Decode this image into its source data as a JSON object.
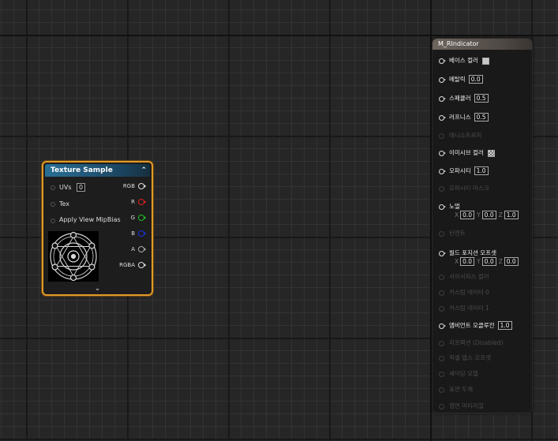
{
  "texture_node": {
    "title": "Texture Sample",
    "collapse_icon": "chevron-up",
    "expand_icon": "chevron-down",
    "inputs": [
      {
        "label": "UVs",
        "value": "0"
      },
      {
        "label": "Tex"
      },
      {
        "label": "Apply View MipBias"
      }
    ],
    "outputs": [
      {
        "label": "RGB",
        "color": "#dddddd"
      },
      {
        "label": "R",
        "color": "#e02020"
      },
      {
        "label": "G",
        "color": "#20c020"
      },
      {
        "label": "B",
        "color": "#2030e0"
      },
      {
        "label": "A",
        "color": "#aaaaaa"
      },
      {
        "label": "RGBA",
        "color": "#dddddd"
      }
    ],
    "thumbnail": "magic-circle-texture"
  },
  "material_node": {
    "title": "M_RIndicator",
    "rows": [
      {
        "label": "베이스 컬러",
        "enabled": true,
        "swatch": "#c8c8c8"
      },
      {
        "label": "메탈릭",
        "enabled": true,
        "value": "0.0"
      },
      {
        "label": "스페큘러",
        "enabled": true,
        "value": "0.5"
      },
      {
        "label": "러프니스",
        "enabled": true,
        "value": "0.5"
      },
      {
        "label": "애니소트로피",
        "enabled": false
      },
      {
        "label": "이미시브 컬러",
        "enabled": true,
        "swatch": "checker"
      },
      {
        "label": "오파시티",
        "enabled": true,
        "value": "1.0"
      },
      {
        "label": "오파시티 마스크",
        "enabled": false
      },
      {
        "label": "노멀",
        "enabled": true,
        "vector": [
          "0.0",
          "0.0",
          "1.0"
        ]
      },
      {
        "label": "탄젠트",
        "enabled": false
      },
      {
        "label": "월드 포지션 오프셋",
        "enabled": true,
        "vector": [
          "0.0",
          "0.0",
          "0.0"
        ]
      },
      {
        "label": "서브서피스 컬러",
        "enabled": false
      },
      {
        "label": "커스텀 데이터 0",
        "enabled": false
      },
      {
        "label": "커스텀 데이터 1",
        "enabled": false
      },
      {
        "label": "앰비언트 오클루전",
        "enabled": true,
        "value": "1.0"
      },
      {
        "label": "리프랙션 (Disabled)",
        "enabled": false
      },
      {
        "label": "픽셀 뎁스 오프셋",
        "enabled": false
      },
      {
        "label": "셰이딩 모델",
        "enabled": false
      },
      {
        "label": "표면 두께",
        "enabled": false
      },
      {
        "label": "정면 머티리얼",
        "enabled": false
      }
    ],
    "axis_labels": [
      "X",
      "Y",
      "Z"
    ]
  }
}
